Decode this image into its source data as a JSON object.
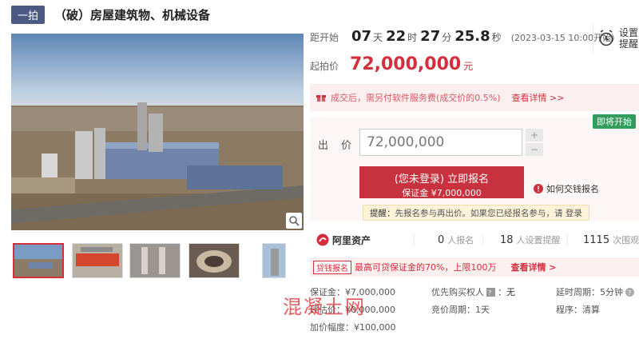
{
  "header": {
    "tag": "一拍",
    "title": "（破）房屋建筑物、机械设备"
  },
  "countdown": {
    "label": "距开始",
    "days": "07",
    "days_unit": "天",
    "hours": "22",
    "hours_unit": "时",
    "minutes": "27",
    "minutes_unit": "分",
    "seconds": "25.8",
    "seconds_unit": "秒",
    "start_note": "(2023-03-15 10:00开始)"
  },
  "remind": {
    "line1": "设置",
    "line2": "提醒"
  },
  "price": {
    "label": "起拍价",
    "value": "72,000,000",
    "unit": "元"
  },
  "fee": {
    "text": "成交后，需另付软件服务费(成交价的0.5%)",
    "link": "查看详情 >>"
  },
  "bid": {
    "badge": "即将开始",
    "label": "出 价",
    "input_value": "72,000,000",
    "plus": "+",
    "minus": "−",
    "signup_main": "(您未登录) 立即报名",
    "signup_sub": "保证金 ¥7,000,000",
    "how_link": "如何交钱报名",
    "tip_key": "提醒：",
    "tip_text": "先报名参与再出价。如果您已经报名参与，请 登录"
  },
  "stats": {
    "brand": "阿里资产",
    "signups_num": "0",
    "signups_label": "人报名",
    "reminders_num": "18",
    "reminders_label": "人设置提醒",
    "views_num": "1115",
    "views_label": "次围观"
  },
  "loan": {
    "tag": "贷钱报名",
    "text": "最高可贷保证金的70%，上限100万",
    "link": "查看详情 >"
  },
  "info": {
    "deposit": "保证金：¥7,000,000",
    "priority": "优先购买权人",
    "priority_val": "无",
    "delay": "延时周期：5分钟",
    "assess": "评估价：¥0,000,000",
    "cycle": "竞价周期：1天",
    "program": "程序：清算",
    "increment": "加价幅度：¥100,000"
  },
  "watermark": "混凝土网",
  "colors": {
    "brand_red": "#d42f3c",
    "tag_blue": "#4a5a82",
    "open_green": "#2f9e5a"
  },
  "icons": [
    "alarm-clock-icon",
    "gift-icon",
    "info-icon",
    "zoom-icon",
    "ali-logo-icon",
    "help-icon"
  ]
}
